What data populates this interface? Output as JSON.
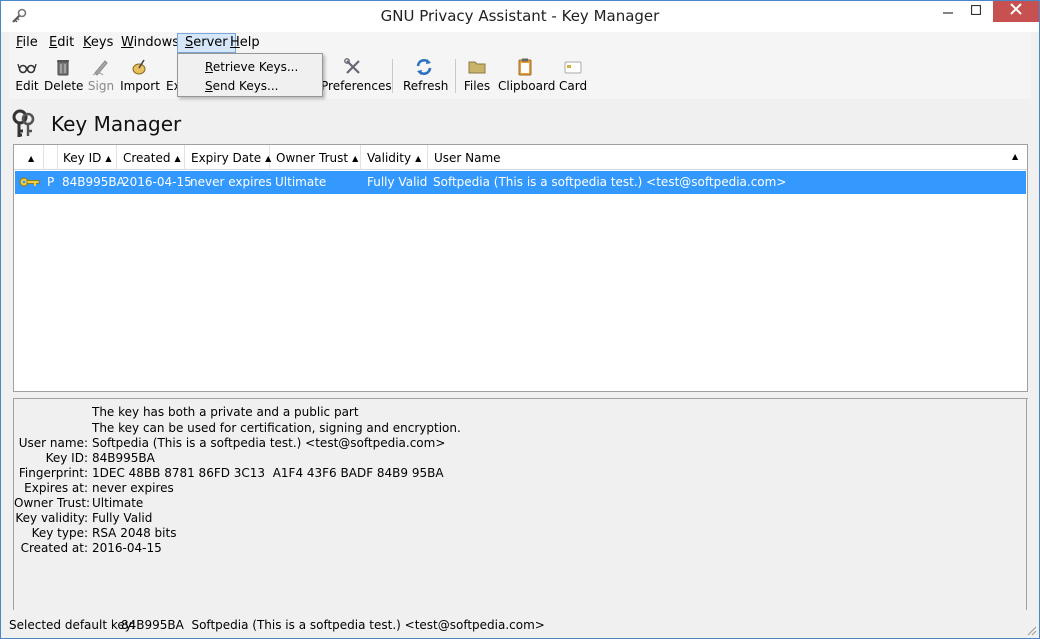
{
  "window": {
    "title": "GNU Privacy Assistant - Key Manager"
  },
  "menubar": {
    "items": [
      {
        "label": "File",
        "u": "F",
        "rest": "ile"
      },
      {
        "label": "Edit",
        "u": "E",
        "rest": "dit"
      },
      {
        "label": "Keys",
        "u": "K",
        "rest": "eys"
      },
      {
        "label": "Windows",
        "u": "W",
        "rest": "indows"
      },
      {
        "label": "Server",
        "u": "S",
        "rest": "erver"
      },
      {
        "label": "Help",
        "u": "H",
        "rest": "elp"
      }
    ]
  },
  "server_menu": {
    "items": [
      {
        "u": "R",
        "rest": "etrieve Keys..."
      },
      {
        "u": "S",
        "rest": "end Keys..."
      }
    ]
  },
  "toolbar": {
    "edit": "Edit",
    "delete": "Delete",
    "sign": "Sign",
    "import": "Import",
    "export": "Ex",
    "preferences": "Preferences",
    "refresh": "Refresh",
    "files": "Files",
    "clipboard": "Clipboard",
    "card": "Card"
  },
  "header": {
    "title": "Key Manager"
  },
  "keylist": {
    "columns": [
      "Key ID",
      "Created",
      "Expiry Date",
      "Owner Trust",
      "Validity",
      "User Name"
    ],
    "rows": [
      {
        "type": "P",
        "key_id": "84B995BA",
        "created": "2016-04-15",
        "expiry": "never expires",
        "owner_trust": "Ultimate",
        "validity": "Fully Valid",
        "user_name": "Softpedia (This is a softpedia test.) <test@softpedia.com>"
      }
    ]
  },
  "details": {
    "line1": "The key has both a private and a public part",
    "line2": "The key can be used for certification, signing and encryption.",
    "fields": [
      {
        "label": "User name:",
        "value": "Softpedia (This is a softpedia test.) <test@softpedia.com>"
      },
      {
        "label": "Key ID:",
        "value": "84B995BA"
      },
      {
        "label": "Fingerprint:",
        "value": "1DEC 48BB 8781 86FD 3C13  A1F4 43F6 BADF 84B9 95BA"
      },
      {
        "label": "Expires at:",
        "value": "never expires"
      },
      {
        "label": "Owner Trust:",
        "value": "Ultimate"
      },
      {
        "label": "Key validity:",
        "value": "Fully Valid"
      },
      {
        "label": "Key type:",
        "value": "RSA 2048 bits"
      },
      {
        "label": "Created at:",
        "value": "2016-04-15"
      }
    ]
  },
  "statusbar": {
    "label": "Selected default key:",
    "value": "84B995BA  Softpedia (This is a softpedia test.) <test@softpedia.com>"
  },
  "colors": {
    "selection": "#3399ff",
    "close_button": "#c75050",
    "menu_highlight": "#d5e7f8"
  }
}
